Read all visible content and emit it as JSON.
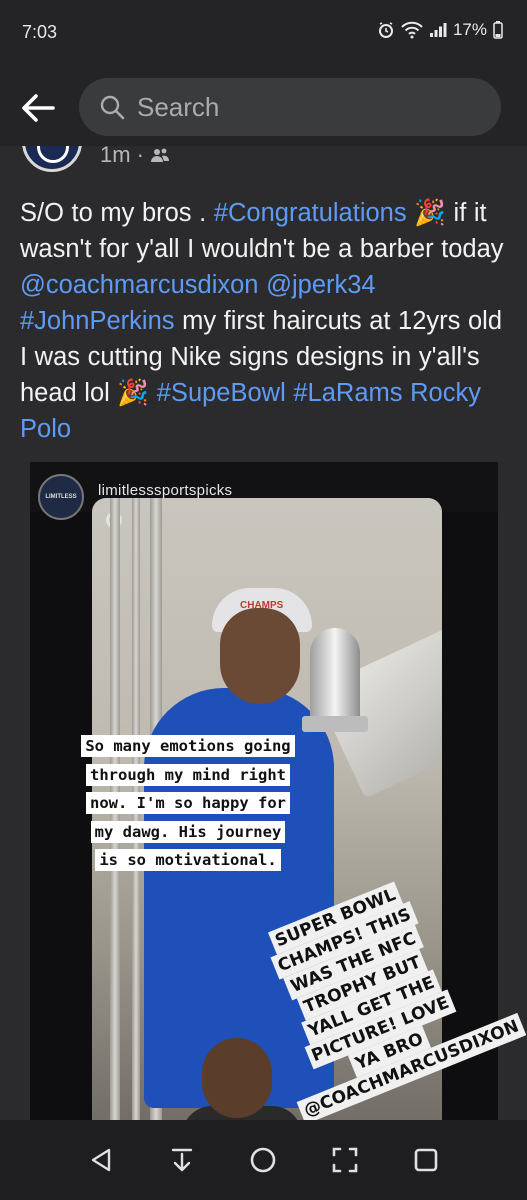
{
  "status_bar": {
    "time": "7:03",
    "battery": "17%"
  },
  "search": {
    "placeholder": "Search"
  },
  "post": {
    "time": "1m ·",
    "text_segments": [
      {
        "t": "S/O  to my bros . ",
        "tag": false
      },
      {
        "t": "#Congratulations",
        "tag": true
      },
      {
        "t": " 🎉 if it wasn't for y'all I wouldn't be a barber today ",
        "tag": false
      },
      {
        "t": "@coachmarcusdixon",
        "tag": true
      },
      {
        "t": " ",
        "tag": false
      },
      {
        "t": "@jperk34",
        "tag": true
      },
      {
        "t": " ",
        "tag": false
      },
      {
        "t": "#JohnPerkins",
        "tag": true
      },
      {
        "t": "  my first haircuts at 12yrs old I was cutting Nike signs designs in y'all's head lol 🎉 ",
        "tag": false
      },
      {
        "t": "#SupeBowl",
        "tag": true
      },
      {
        "t": " ",
        "tag": false
      },
      {
        "t": "#LaRams",
        "tag": true
      },
      {
        "t": " ",
        "tag": false
      },
      {
        "t": "Rocky Polo",
        "tag": true
      }
    ]
  },
  "media": {
    "account_badge": "LIMITLESS",
    "account_name": "limitlesssportspicks",
    "caption_lines": [
      "So many emotions going",
      "through my mind right",
      "now. I'm so happy for",
      "my dawg. His journey",
      "is so motivational."
    ],
    "sticker_lines": [
      "SUPER BOWL CHAMPS! THIS",
      "WAS THE NFC TROPHY BUT",
      "YALL GET THE PICTURE! LOVE",
      "YA BRO @COACHMARCUSDIXON"
    ],
    "cap_text": "CHAMPS"
  },
  "colors": {
    "background": "#2b2b2d",
    "link": "#5e9bf7",
    "text": "#f2f2f2"
  },
  "icons": {
    "back": "arrow-left-icon",
    "search": "magnifier-icon",
    "audience": "friends-icon",
    "nav": [
      "back-triangle-icon",
      "download-icon",
      "home-circle-icon",
      "screenshot-frame-icon",
      "recents-square-icon"
    ]
  }
}
